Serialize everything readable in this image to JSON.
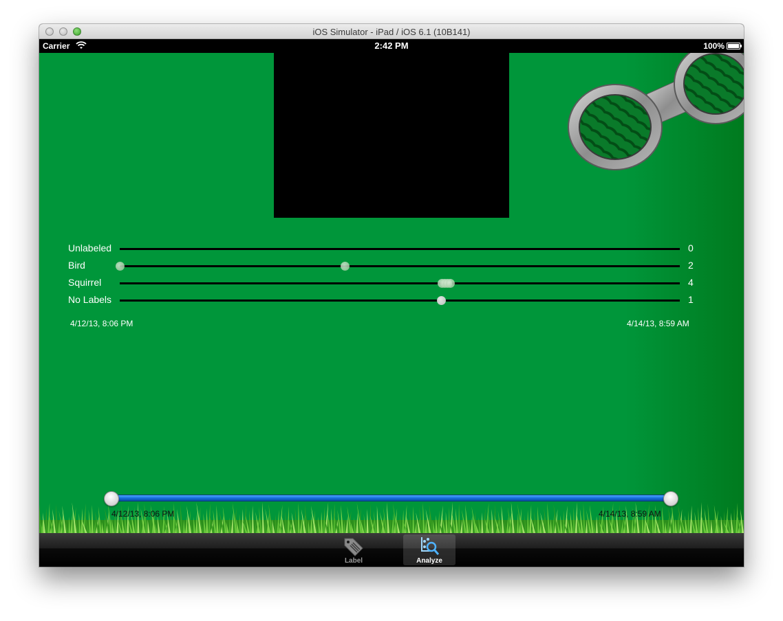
{
  "window": {
    "title": "iOS Simulator - iPad / iOS 6.1 (10B141)"
  },
  "status_bar": {
    "carrier": "Carrier",
    "time": "2:42 PM",
    "battery": "100%"
  },
  "timeline": {
    "rows": [
      {
        "label": "Unlabeled",
        "count": "0"
      },
      {
        "label": "Bird",
        "count": "2"
      },
      {
        "label": "Squirrel",
        "count": "4"
      },
      {
        "label": "No Labels",
        "count": "1"
      }
    ],
    "start_label": "4/12/13, 8:06 PM",
    "end_label": "4/14/13, 8:59 AM"
  },
  "range_slider": {
    "min_label": "4/12/13, 8:06 PM",
    "max_label": "4/14/13, 8:59 AM",
    "range_start": 0,
    "range_end": 1
  },
  "tabs": [
    {
      "label": "Label",
      "icon": "tag-icon",
      "selected": false
    },
    {
      "label": "Analyze",
      "icon": "analyze-icon",
      "selected": true
    }
  ],
  "colors": {
    "background": "#00963a",
    "slider": "#1e7de6"
  }
}
